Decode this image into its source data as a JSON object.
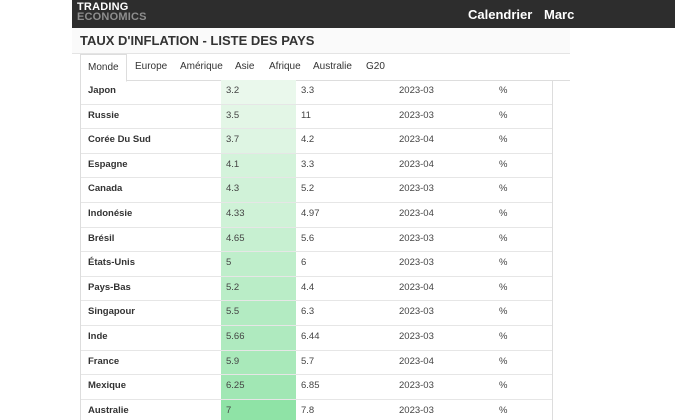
{
  "header": {
    "logo_line1": "TRADING",
    "logo_line2": "ECONOMICS",
    "nav": [
      "Calendrier",
      "Marc"
    ]
  },
  "page": {
    "title": "TAUX D'INFLATION - LISTE DES PAYS"
  },
  "tabs": [
    {
      "label": "Monde",
      "active": true
    },
    {
      "label": "Europe",
      "active": false
    },
    {
      "label": "Amérique",
      "active": false
    },
    {
      "label": "Asie",
      "active": false
    },
    {
      "label": "Afrique",
      "active": false
    },
    {
      "label": "Australie",
      "active": false
    },
    {
      "label": "G20",
      "active": false
    }
  ],
  "colors": {
    "heat_min": "#eaf8ec",
    "heat_max": "#8fe3a6"
  },
  "rows": [
    {
      "country": "Japon",
      "last": "3.2",
      "previous": "3.3",
      "reference": "2023-03",
      "unit": "%"
    },
    {
      "country": "Russie",
      "last": "3.5",
      "previous": "11",
      "reference": "2023-03",
      "unit": "%"
    },
    {
      "country": "Corée Du Sud",
      "last": "3.7",
      "previous": "4.2",
      "reference": "2023-04",
      "unit": "%"
    },
    {
      "country": "Espagne",
      "last": "4.1",
      "previous": "3.3",
      "reference": "2023-04",
      "unit": "%"
    },
    {
      "country": "Canada",
      "last": "4.3",
      "previous": "5.2",
      "reference": "2023-03",
      "unit": "%"
    },
    {
      "country": "Indonésie",
      "last": "4.33",
      "previous": "4.97",
      "reference": "2023-04",
      "unit": "%"
    },
    {
      "country": "Brésil",
      "last": "4.65",
      "previous": "5.6",
      "reference": "2023-03",
      "unit": "%"
    },
    {
      "country": "États-Unis",
      "last": "5",
      "previous": "6",
      "reference": "2023-03",
      "unit": "%"
    },
    {
      "country": "Pays-Bas",
      "last": "5.2",
      "previous": "4.4",
      "reference": "2023-04",
      "unit": "%"
    },
    {
      "country": "Singapour",
      "last": "5.5",
      "previous": "6.3",
      "reference": "2023-03",
      "unit": "%"
    },
    {
      "country": "Inde",
      "last": "5.66",
      "previous": "6.44",
      "reference": "2023-03",
      "unit": "%"
    },
    {
      "country": "France",
      "last": "5.9",
      "previous": "5.7",
      "reference": "2023-04",
      "unit": "%"
    },
    {
      "country": "Mexique",
      "last": "6.25",
      "previous": "6.85",
      "reference": "2023-03",
      "unit": "%"
    },
    {
      "country": "Australie",
      "last": "7",
      "previous": "7.8",
      "reference": "2023-03",
      "unit": "%"
    }
  ]
}
